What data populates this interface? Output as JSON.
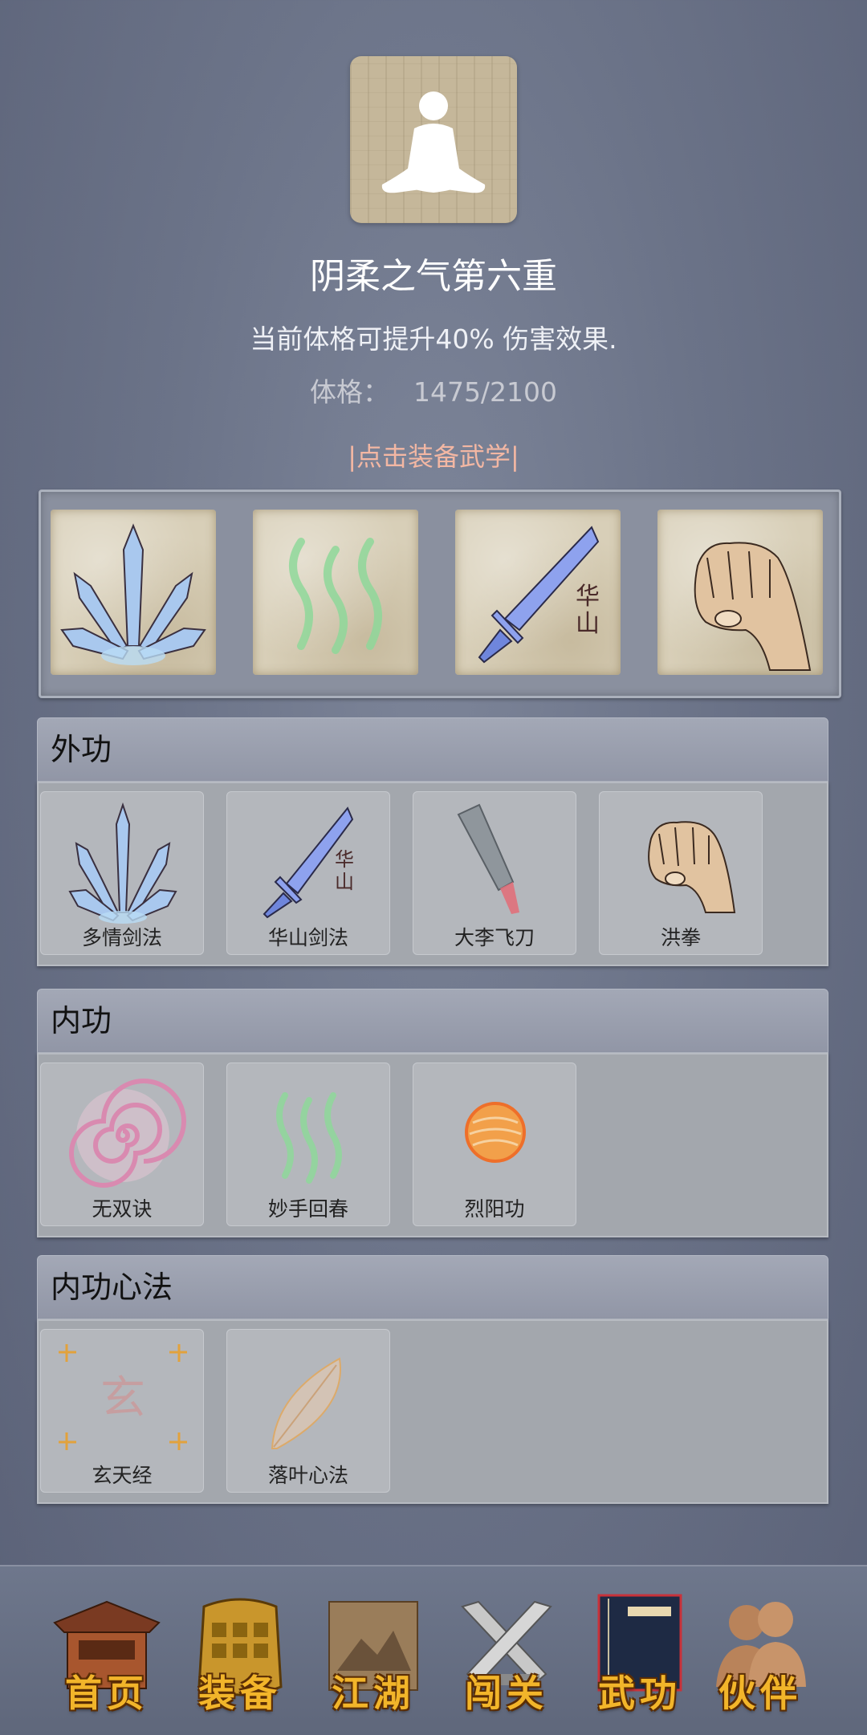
{
  "header": {
    "title": "阴柔之气第六重",
    "description": "当前体格可提升40% 伤害效果.",
    "stat_label": "体格：",
    "stat_value": "1475/2100",
    "equip_link": "|点击装备武学|"
  },
  "equipped_slots": [
    {
      "icon": "crystal-blades-icon"
    },
    {
      "icon": "green-wave-icon"
    },
    {
      "icon": "huashan-sword-icon",
      "glyph": "华山"
    },
    {
      "icon": "fist-icon"
    }
  ],
  "sections": [
    {
      "title": "外功",
      "skills": [
        {
          "name": "多情剑法",
          "icon": "crystal-blades-icon"
        },
        {
          "name": "华山剑法",
          "icon": "huashan-sword-icon",
          "glyph": "华山"
        },
        {
          "name": "大李飞刀",
          "icon": "flying-knife-icon"
        },
        {
          "name": "洪拳",
          "icon": "fist-icon"
        }
      ]
    },
    {
      "title": "内功",
      "skills": [
        {
          "name": "无双诀",
          "icon": "spiral-icon"
        },
        {
          "name": "妙手回春",
          "icon": "green-wave-icon"
        },
        {
          "name": "烈阳功",
          "icon": "sun-orb-icon"
        }
      ]
    },
    {
      "title": "内功心法",
      "skills": [
        {
          "name": "玄天经",
          "icon": "xuan-scroll-icon",
          "glyph": "玄"
        },
        {
          "name": "落叶心法",
          "icon": "leaf-icon"
        }
      ]
    }
  ],
  "nav": [
    {
      "label": "首页",
      "icon": "home-temple-icon"
    },
    {
      "label": "装备",
      "icon": "armor-icon"
    },
    {
      "label": "江湖",
      "icon": "scroll-map-icon"
    },
    {
      "label": "闯关",
      "icon": "crossed-swords-icon"
    },
    {
      "label": "武功",
      "icon": "book-icon"
    },
    {
      "label": "伙伴",
      "icon": "companions-icon"
    }
  ]
}
